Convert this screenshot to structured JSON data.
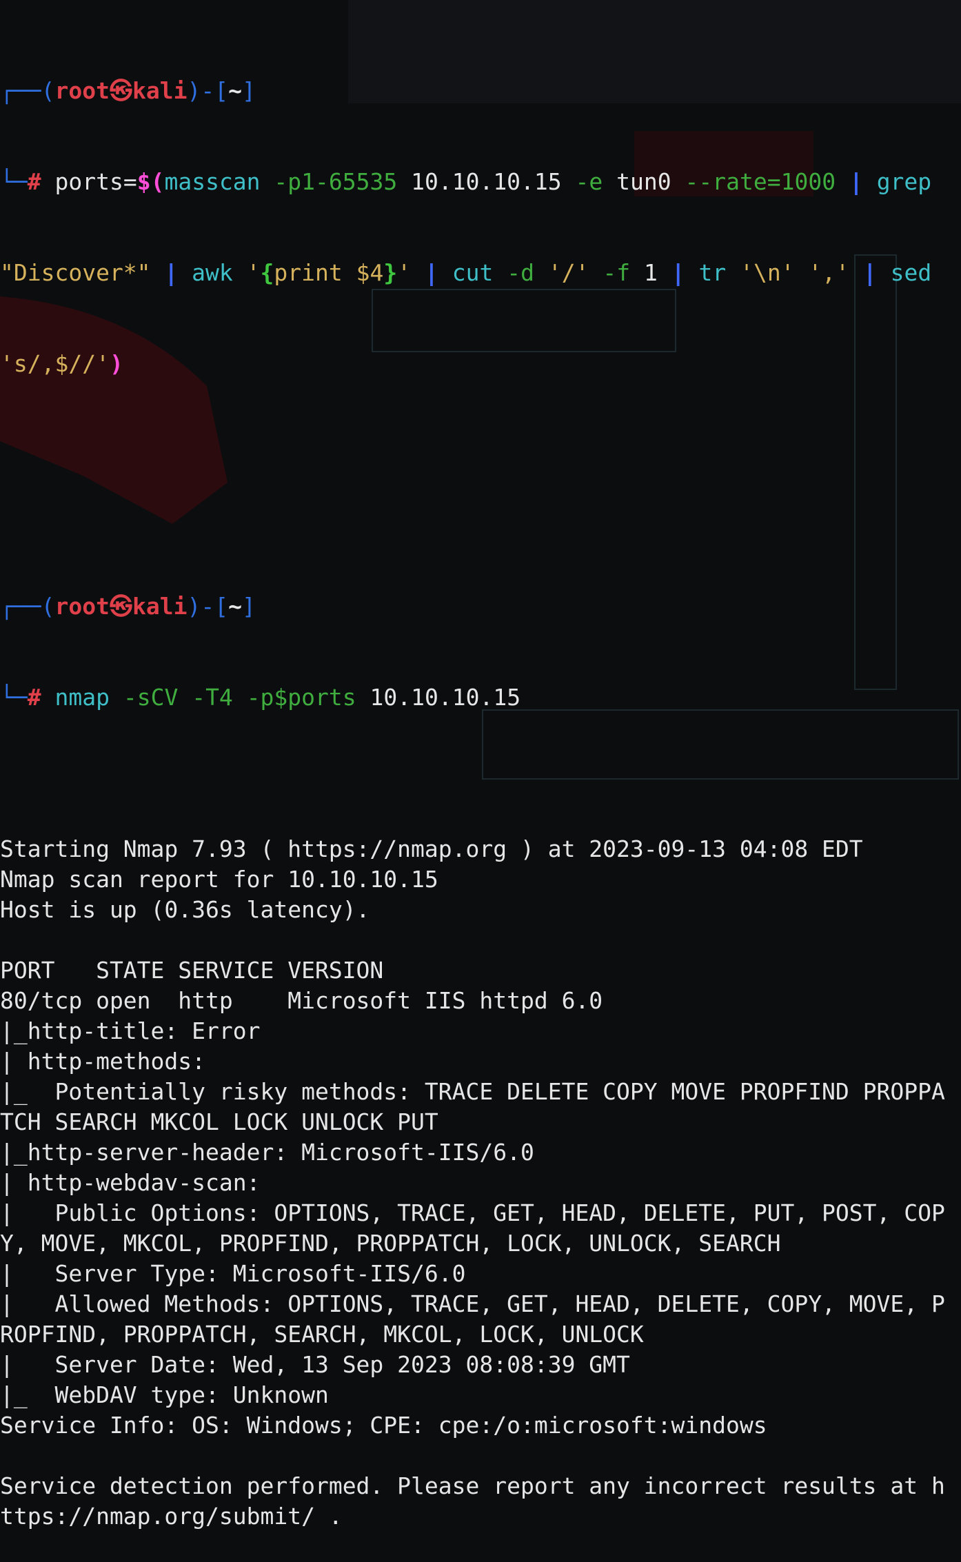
{
  "prompt1": {
    "user": "root",
    "host": "kali",
    "cwd": "~",
    "command": {
      "var": "ports=",
      "dollar": "$",
      "paren_open": "(",
      "masscan": "masscan",
      "masscan_port": "-p1-65535",
      "target": "10.10.10.15",
      "iface_flag": "-e",
      "iface": "tun0",
      "rate": "--rate=1000",
      "pipe": "|",
      "grep": "grep",
      "grep_pattern": "\"Discover*\"",
      "awk": "awk",
      "awk_q1": "'",
      "awk_brace_open": "{",
      "awk_body": "print $4",
      "awk_brace_close": "}",
      "awk_q2": "'",
      "cut": "cut",
      "cut_d": "-d",
      "cut_delim": "'/'",
      "cut_f": "-f",
      "cut_field": "1",
      "tr": "tr",
      "tr_from": "'\\n'",
      "tr_to": "','",
      "sed": "sed",
      "sed_expr": "'s/,$//'",
      "paren_close": ")"
    }
  },
  "prompt2": {
    "user": "root",
    "host": "kali",
    "cwd": "~",
    "command": {
      "nmap": "nmap",
      "flags": "-sCV -T4",
      "port_flag": "-p$ports",
      "target": "10.10.10.15"
    }
  },
  "output": [
    "Starting Nmap 7.93 ( https://nmap.org ) at 2023-09-13 04:08 EDT",
    "Nmap scan report for 10.10.10.15",
    "Host is up (0.36s latency).",
    "",
    "PORT   STATE SERVICE VERSION",
    "80/tcp open  http    Microsoft IIS httpd 6.0",
    "|_http-title: Error",
    "| http-methods:",
    "|_  Potentially risky methods: TRACE DELETE COPY MOVE PROPFIND PROPPA",
    "TCH SEARCH MKCOL LOCK UNLOCK PUT",
    "|_http-server-header: Microsoft-IIS/6.0",
    "| http-webdav-scan:",
    "|   Public Options: OPTIONS, TRACE, GET, HEAD, DELETE, PUT, POST, COP",
    "Y, MOVE, MKCOL, PROPFIND, PROPPATCH, LOCK, UNLOCK, SEARCH",
    "|   Server Type: Microsoft-IIS/6.0",
    "|   Allowed Methods: OPTIONS, TRACE, GET, HEAD, DELETE, COPY, MOVE, P",
    "ROPFIND, PROPPATCH, SEARCH, MKCOL, LOCK, UNLOCK",
    "|   Server Date: Wed, 13 Sep 2023 08:08:39 GMT",
    "|_  WebDAV type: Unknown",
    "Service Info: OS: Windows; CPE: cpe:/o:microsoft:windows",
    "",
    "Service detection performed. Please report any incorrect results at h",
    "ttps://nmap.org/submit/ ."
  ],
  "colors": {
    "background": "#0c0d0f",
    "prompt_box": "#2f6fe0",
    "prompt_user": "#e0404a",
    "command": "#3fbfc8",
    "option": "#3fae3f",
    "pipe": "#3f68ff",
    "string": "#d6b25c",
    "output": "#e6e6e6"
  }
}
